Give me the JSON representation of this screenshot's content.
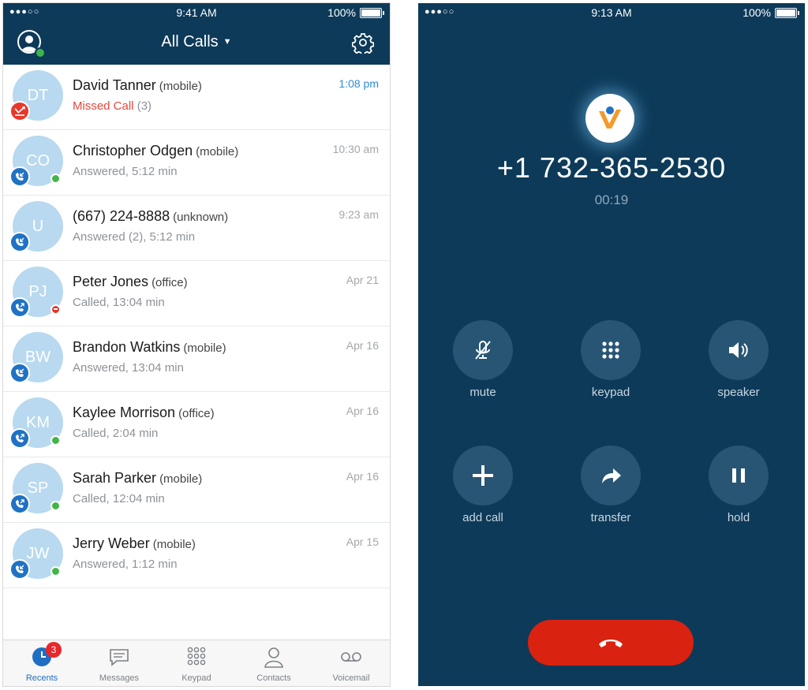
{
  "left": {
    "status": {
      "signal": "●●●○○",
      "time": "9:41 AM",
      "battery": "100%"
    },
    "header": {
      "title": "All Calls"
    },
    "calls": [
      {
        "initials": "DT",
        "name": "David Tanner",
        "type": "(mobile)",
        "detail": "Missed Call",
        "count": "(3)",
        "time": "1:08 pm",
        "direction": "missed",
        "presence": "none"
      },
      {
        "initials": "CO",
        "name": "Christopher Odgen",
        "type": "(mobile)",
        "detail": "Answered, 5:12 min",
        "time": "10:30 am",
        "direction": "incoming",
        "presence": "available"
      },
      {
        "initials": "U",
        "name": "(667) 224-8888",
        "type": "(unknown)",
        "detail": "Answered (2), 5:12 min",
        "time": "9:23 am",
        "direction": "incoming",
        "presence": "none"
      },
      {
        "initials": "PJ",
        "name": "Peter Jones",
        "type": "(office)",
        "detail": "Called, 13:04 min",
        "time": "Apr 21",
        "direction": "outgoing",
        "presence": "dnd"
      },
      {
        "initials": "BW",
        "name": "Brandon Watkins",
        "type": "(mobile)",
        "detail": "Answered, 13:04 min",
        "time": "Apr 16",
        "direction": "incoming",
        "presence": "none"
      },
      {
        "initials": "KM",
        "name": "Kaylee Morrison",
        "type": "(office)",
        "detail": "Called, 2:04 min",
        "time": "Apr 16",
        "direction": "outgoing",
        "presence": "available"
      },
      {
        "initials": "SP",
        "name": "Sarah Parker",
        "type": "(mobile)",
        "detail": "Called, 12:04 min",
        "time": "Apr 16",
        "direction": "outgoing",
        "presence": "available"
      },
      {
        "initials": "JW",
        "name": "Jerry Weber",
        "type": "(mobile)",
        "detail": "Answered, 1:12 min",
        "time": "Apr 15",
        "direction": "incoming",
        "presence": "available"
      }
    ],
    "tabs": [
      {
        "label": "Recents",
        "icon": "recents-clock-icon",
        "badge": "3",
        "active": true
      },
      {
        "label": "Messages",
        "icon": "messages-bubble-icon"
      },
      {
        "label": "Keypad",
        "icon": "keypad-grid-icon"
      },
      {
        "label": "Contacts",
        "icon": "contacts-person-icon"
      },
      {
        "label": "Voicemail",
        "icon": "voicemail-icon"
      }
    ],
    "colors": {
      "header": "#0d3a59",
      "missed": "#e8473c",
      "accent": "#2c8dd6",
      "presence": "#43b548"
    }
  },
  "right": {
    "status": {
      "signal": "●●●○○",
      "time": "9:13 AM",
      "battery": "100%"
    },
    "call": {
      "number": "+1 732-365-2530",
      "duration": "00:19"
    },
    "controls": {
      "mute": "mute",
      "keypad": "keypad",
      "speaker": "speaker",
      "add_call": "add call",
      "transfer": "transfer",
      "hold": "hold"
    },
    "colors": {
      "background": "#0d3a59",
      "end_call": "#d9220f"
    }
  }
}
